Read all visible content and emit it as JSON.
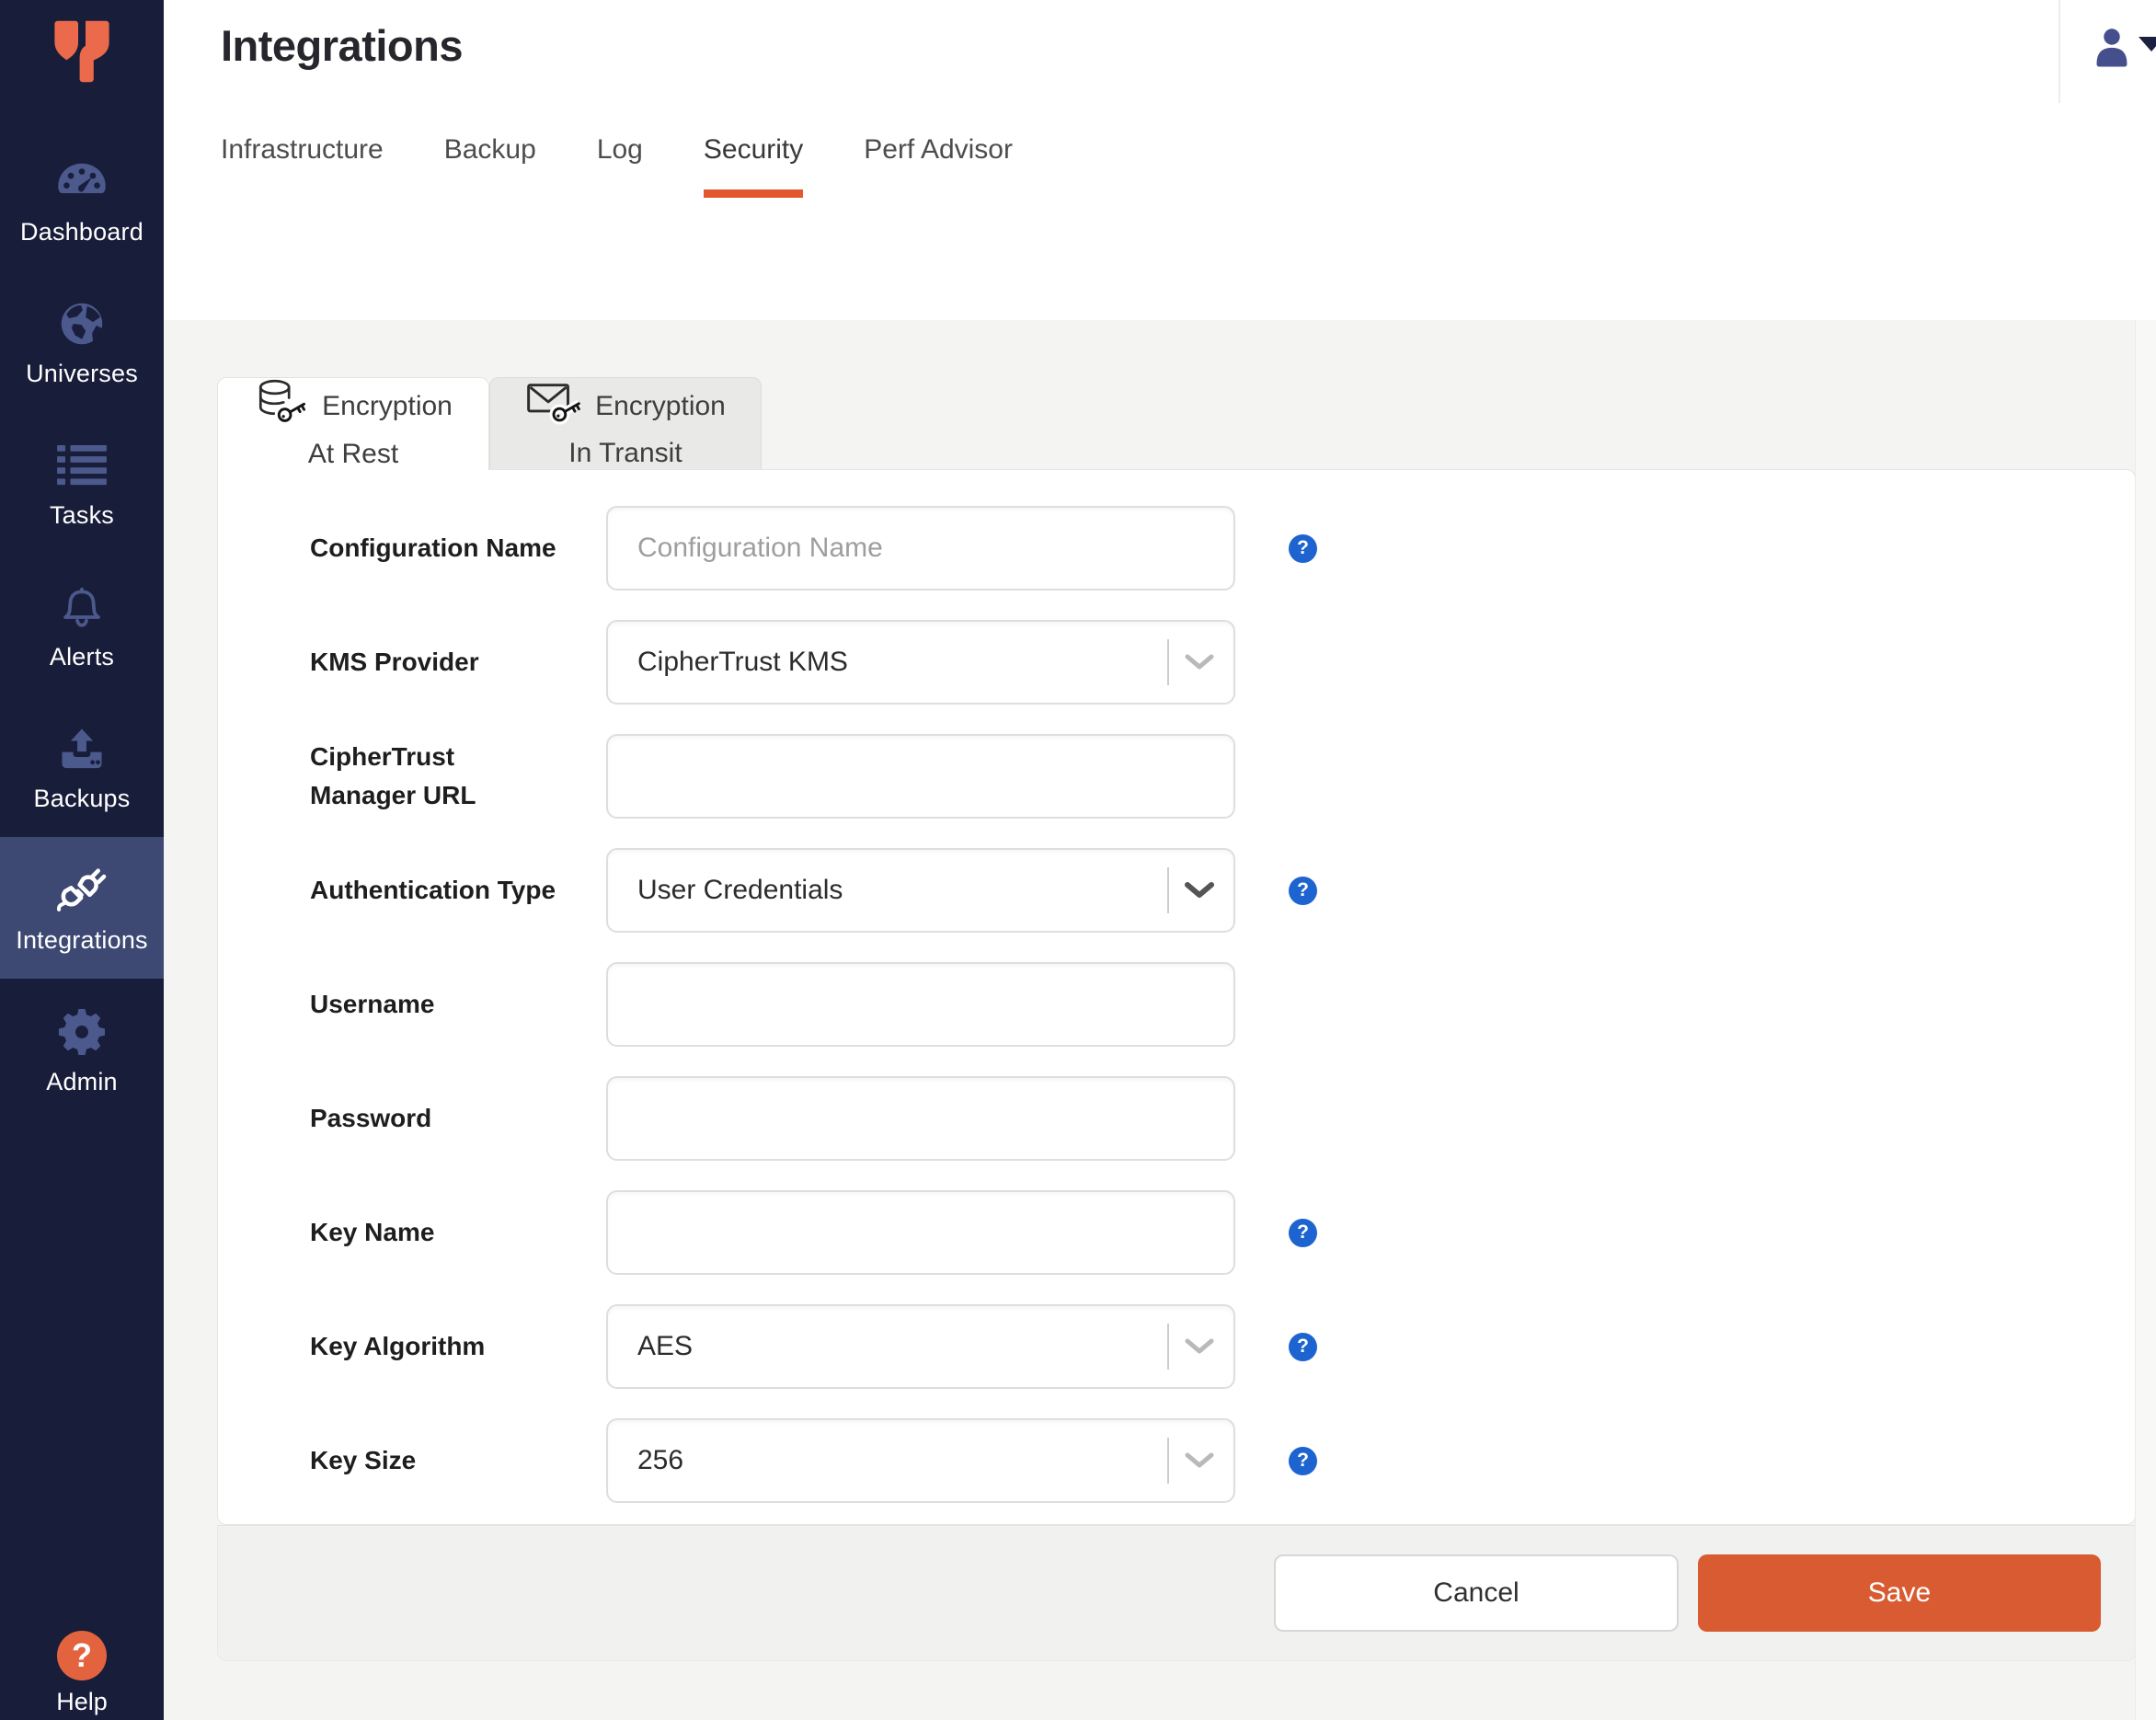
{
  "sidebar": {
    "items": [
      {
        "label": "Dashboard",
        "slug": "dashboard",
        "icon": "dashboard-gauge-icon",
        "active": false
      },
      {
        "label": "Universes",
        "slug": "universes",
        "icon": "universes-globe-icon",
        "active": false
      },
      {
        "label": "Tasks",
        "slug": "tasks",
        "icon": "tasks-list-icon",
        "active": false
      },
      {
        "label": "Alerts",
        "slug": "alerts",
        "icon": "alerts-bell-icon",
        "active": false
      },
      {
        "label": "Backups",
        "slug": "backups",
        "icon": "backups-upload-icon",
        "active": false
      },
      {
        "label": "Integrations",
        "slug": "integrations",
        "icon": "integrations-plug-icon",
        "active": true
      },
      {
        "label": "Admin",
        "slug": "admin",
        "icon": "admin-gear-icon",
        "active": false
      }
    ],
    "help_label": "Help"
  },
  "header": {
    "title": "Integrations",
    "tabs": [
      {
        "label": "Infrastructure",
        "slug": "infrastructure",
        "active": false
      },
      {
        "label": "Backup",
        "slug": "backup",
        "active": false
      },
      {
        "label": "Log",
        "slug": "log",
        "active": false
      },
      {
        "label": "Security",
        "slug": "security",
        "active": true
      },
      {
        "label": "Perf Advisor",
        "slug": "perf-advisor",
        "active": false
      }
    ]
  },
  "encryption_tabs": [
    {
      "line1": "Encryption",
      "line2": "At Rest",
      "slug": "encryption-at-rest",
      "icon": "database-key-icon",
      "active": true
    },
    {
      "line1": "Encryption",
      "line2": "In Transit",
      "slug": "encryption-in-transit",
      "icon": "envelope-key-icon",
      "active": false
    }
  ],
  "form": {
    "fields": [
      {
        "label": "Configuration Name",
        "slug": "configuration-name",
        "type": "text",
        "value": "",
        "placeholder": "Configuration Name",
        "help": true,
        "chevron": null
      },
      {
        "label": "KMS Provider",
        "slug": "kms-provider",
        "type": "select",
        "value": "CipherTrust KMS",
        "placeholder": "",
        "help": false,
        "chevron": "light"
      },
      {
        "label": "CipherTrust\nManager URL",
        "slug": "ciphertrust-manager-url",
        "type": "text",
        "value": "",
        "placeholder": "",
        "help": false,
        "chevron": null
      },
      {
        "label": "Authentication Type",
        "slug": "authentication-type",
        "type": "select",
        "value": "User Credentials",
        "placeholder": "",
        "help": true,
        "chevron": "dark"
      },
      {
        "label": "Username",
        "slug": "username",
        "type": "text",
        "value": "",
        "placeholder": "",
        "help": false,
        "chevron": null
      },
      {
        "label": "Password",
        "slug": "password",
        "type": "text",
        "value": "",
        "placeholder": "",
        "help": false,
        "chevron": null
      },
      {
        "label": "Key Name",
        "slug": "key-name",
        "type": "text",
        "value": "",
        "placeholder": "",
        "help": true,
        "chevron": null
      },
      {
        "label": "Key Algorithm",
        "slug": "key-algorithm",
        "type": "select",
        "value": "AES",
        "placeholder": "",
        "help": true,
        "chevron": "light"
      },
      {
        "label": "Key Size",
        "slug": "key-size",
        "type": "select",
        "value": "256",
        "placeholder": "",
        "help": true,
        "chevron": "light"
      }
    ],
    "cancel_label": "Cancel",
    "save_label": "Save"
  },
  "colors": {
    "sidebar_bg": "#181d3a",
    "sidebar_active_bg": "#3d4873",
    "sidebar_icon": "#4c598c",
    "accent_orange": "#e2572d",
    "save_button": "#d95b32",
    "help_icon_blue": "#1d64d0",
    "help_circle_orange": "#e2633e",
    "content_bg": "#f4f4f3",
    "avatar_indigo": "#454f8b"
  }
}
